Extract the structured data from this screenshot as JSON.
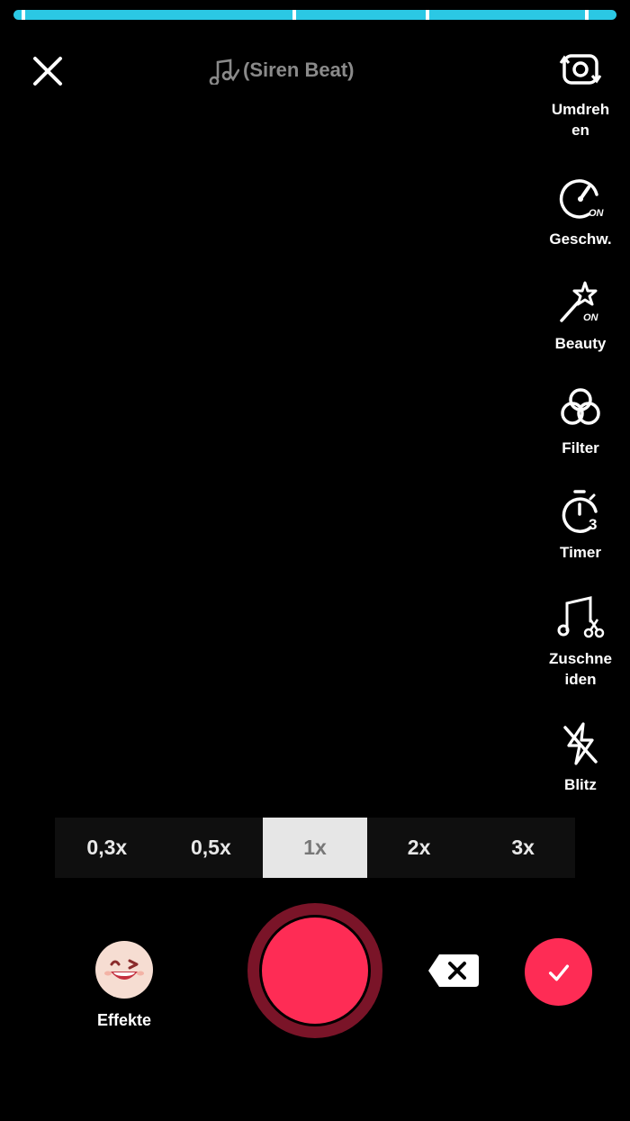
{
  "top": {
    "sound_name": "(Siren Beat)"
  },
  "rail": {
    "flip": "Umdreh\nen",
    "speed": "Geschw.",
    "speed_badge": "ON",
    "beauty": "Beauty",
    "beauty_badge": "ON",
    "filter": "Filter",
    "timer": "Timer",
    "timer_badge": "3",
    "trim": "Zuschne\niden",
    "flash": "Blitz"
  },
  "zoom": {
    "options": [
      "0,3x",
      "0,5x",
      "1x",
      "2x",
      "3x"
    ],
    "selected": "1x"
  },
  "bottom": {
    "effects_label": "Effekte"
  },
  "colors": {
    "accent": "#fe2c55",
    "progress": "#2bc8e4"
  }
}
